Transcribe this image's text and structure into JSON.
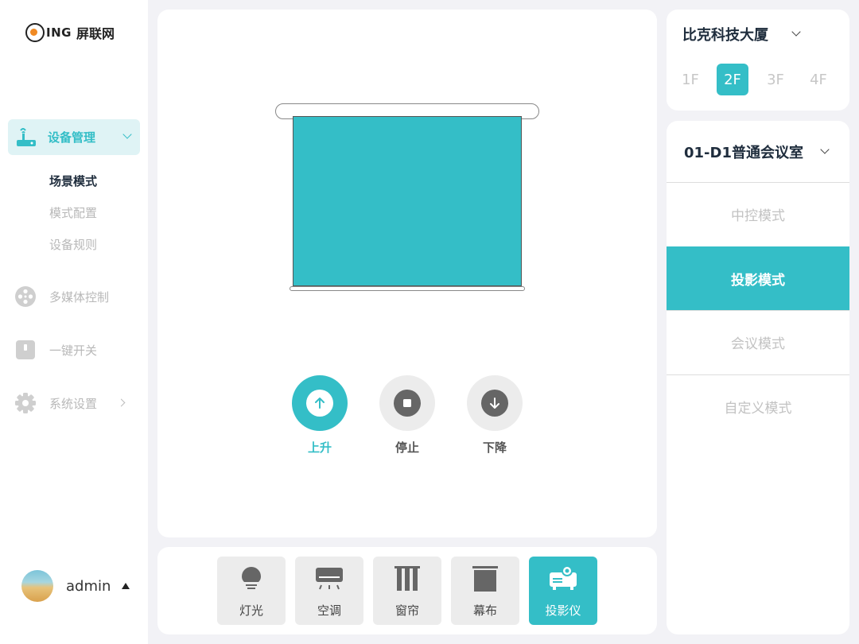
{
  "brand": {
    "logo_letters": "ING",
    "name": "屏联网"
  },
  "sidebar": {
    "active_item": {
      "label": "设备管理",
      "icon": "router-icon"
    },
    "subitems": [
      {
        "label": "场景模式",
        "active": true
      },
      {
        "label": "模式配置",
        "active": false
      },
      {
        "label": "设备规则",
        "active": false
      }
    ],
    "items": [
      {
        "label": "多媒体控制",
        "icon": "film-reel-icon"
      },
      {
        "label": "一键开关",
        "icon": "switch-icon"
      },
      {
        "label": "系统设置",
        "icon": "gear-icon"
      }
    ]
  },
  "user": {
    "name": "admin"
  },
  "screen_controls": [
    {
      "label": "上升",
      "icon": "arrow-up-icon",
      "active": true
    },
    {
      "label": "停止",
      "icon": "stop-icon",
      "active": false
    },
    {
      "label": "下降",
      "icon": "arrow-down-icon",
      "active": false
    }
  ],
  "devices": [
    {
      "label": "灯光",
      "icon": "bulb-icon",
      "active": false
    },
    {
      "label": "空调",
      "icon": "air-conditioner-icon",
      "active": false
    },
    {
      "label": "窗帘",
      "icon": "curtain-icon",
      "active": false
    },
    {
      "label": "幕布",
      "icon": "screen-icon",
      "active": false
    },
    {
      "label": "投影仪",
      "icon": "projector-icon",
      "active": true
    }
  ],
  "building": {
    "name": "比克科技大厦",
    "floors": [
      "1F",
      "2F",
      "3F",
      "4F"
    ],
    "selected_floor": "2F"
  },
  "room": {
    "name": "01-D1普通会议室",
    "modes": [
      "中控模式",
      "投影模式",
      "会议模式",
      "自定义模式"
    ],
    "selected_mode": "投影模式"
  },
  "colors": {
    "accent": "#34bec7",
    "background": "#f2f2f6"
  }
}
